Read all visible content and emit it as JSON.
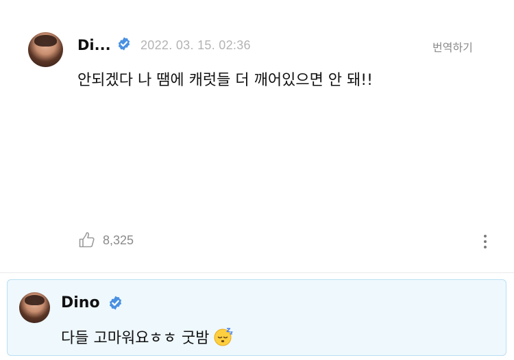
{
  "post": {
    "author": "Di...",
    "timestamp": "2022. 03. 15. 02:36",
    "translate_label": "번역하기",
    "body": "안되겠다 나 땜에 캐럿들 더 깨어있으면 안 돼!!",
    "like_count": "8,325"
  },
  "reply": {
    "author": "Dino",
    "body": "다들 고마워요ㅎㅎ 굿밤"
  },
  "colors": {
    "verified_badge": "#4a90e2",
    "reply_background": "#eef8fd",
    "reply_border": "#b9dff2",
    "muted_text": "#8a8a8a"
  },
  "icons": [
    "verified-badge-icon",
    "thumbs-up-icon",
    "more-vertical-icon",
    "sleeping-face-emoji"
  ]
}
